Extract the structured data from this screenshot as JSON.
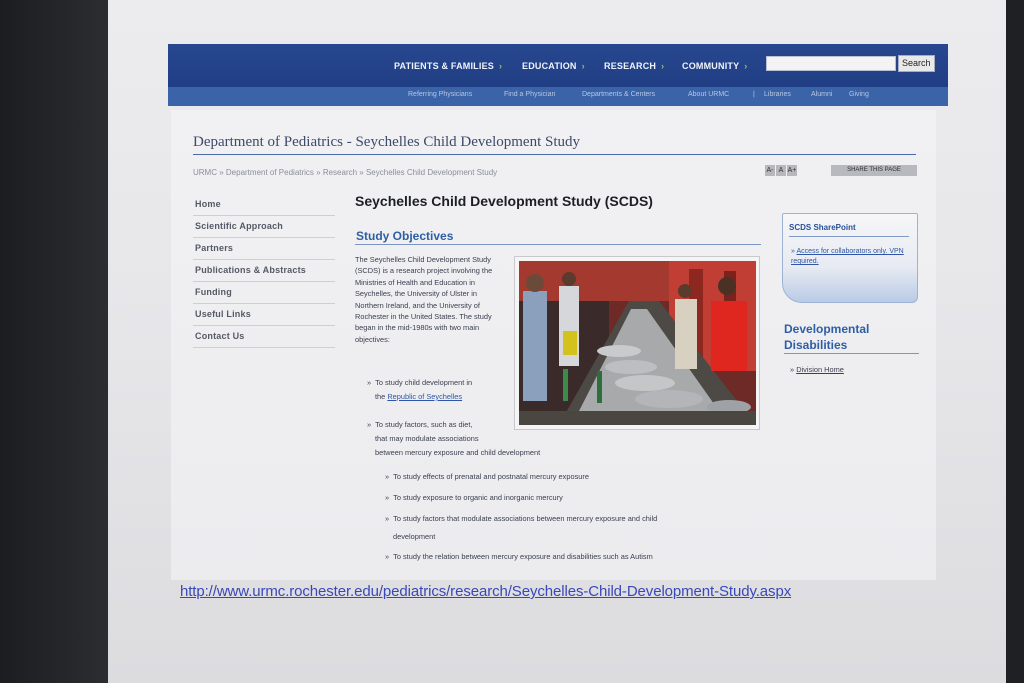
{
  "nav": {
    "items": [
      "PATIENTS & FAMILIES",
      "EDUCATION",
      "RESEARCH",
      "COMMUNITY"
    ],
    "chevron": "›",
    "search_button": "Search",
    "sub_items": [
      "Referring Physicians",
      "Find a Physician",
      "Departments & Centers",
      "About URMC",
      "|",
      "Libraries",
      "Alumni",
      "Giving"
    ]
  },
  "page": {
    "dept_title": "Department of Pediatrics - Seychelles Child Development Study",
    "breadcrumb": "URMC » Department of Pediatrics » Research » Seychelles Child Development Study",
    "text_size": [
      "A-",
      "A",
      "A+"
    ],
    "share": "SHARE THIS PAGE"
  },
  "sidebar": {
    "items": [
      "Home",
      "Scientific Approach",
      "Partners",
      "Publications & Abstracts",
      "Funding",
      "Useful Links",
      "Contact Us"
    ]
  },
  "main": {
    "title": "Seychelles Child Development Study (SCDS)",
    "section_title": "Study Objectives",
    "intro": "The Seychelles Child Development Study (SCDS) is a research project involving the Ministries of Health and Education in Seychelles, the University of Ulster in Northern Ireland, and the University of Rochester in the United States. The study began in the mid-1980s with two main objectives:",
    "bullet1_pre": "To study child development in",
    "bullet1_pre2": "the",
    "bullet1_link": "Republic of Seychelles",
    "bullet2_line1": "To study factors, such as diet,",
    "bullet2_line2": "that may modulate associations",
    "bullet2_line3": "between mercury exposure and child development",
    "sub_bullets": [
      "To study effects of prenatal and postnatal mercury exposure",
      "To study exposure to organic and inorganic mercury",
      "To study factors that modulate associations between mercury exposure and child",
      "development",
      "To study the relation between mercury exposure and disabilities such as Autism"
    ],
    "bullet_mark": "»"
  },
  "right": {
    "sharepoint_title": "SCDS SharePoint",
    "sharepoint_link": "Access for collaborators only. VPN required.",
    "dev_title_line1": "Developmental",
    "dev_title_line2": "Disabilities",
    "division_link": "Division Home"
  },
  "url": "http://www.urmc.rochester.edu/pediatrics/research/Seychelles-Child-Development-Study.aspx",
  "colors": {
    "nav_bg": "#203e84",
    "subnav_bg": "#3a63a8",
    "accent_blue": "#2f5ea5",
    "link_blue": "#3848b8"
  }
}
